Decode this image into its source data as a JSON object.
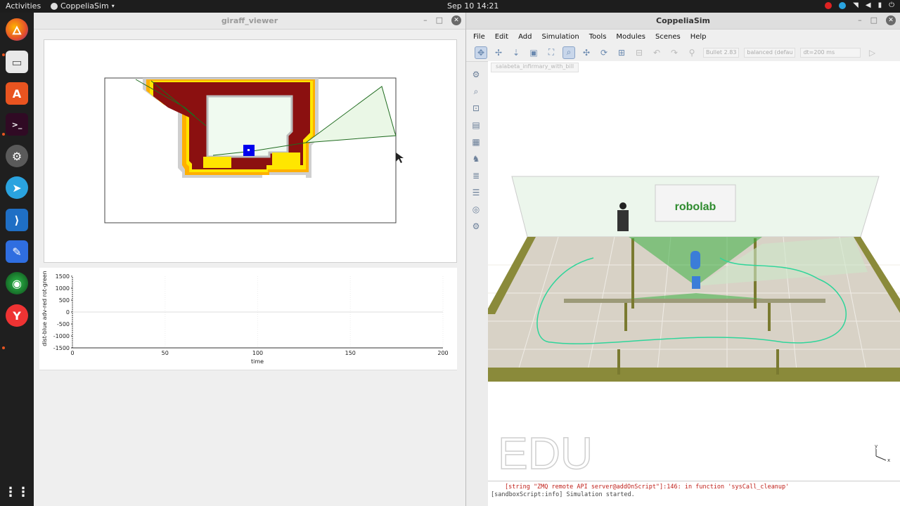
{
  "topbar": {
    "activities": "Activities",
    "app_name": "CoppeliaSim",
    "clock": "Sep 10  14:21"
  },
  "dock": {
    "icons": [
      "firefox-icon",
      "files-icon",
      "app-center-icon",
      "terminal-icon",
      "settings-icon",
      "telegram-icon",
      "vscode-icon",
      "text-editor-icon",
      "robotics-icon",
      "coppelia-icon",
      "show-apps-icon"
    ]
  },
  "giraff": {
    "title": "giraff_viewer",
    "plot": {
      "ylabel": "dist-blue adv-red rot-green",
      "xlabel": "time",
      "yticks": [
        "1500",
        "1000",
        "500",
        "0",
        "-500",
        "-1000",
        "-1500"
      ],
      "xticks": [
        "0",
        "50",
        "100",
        "150",
        "200"
      ]
    }
  },
  "coppelia": {
    "title": "CoppeliaSim",
    "menu": [
      "File",
      "Edit",
      "Add",
      "Simulation",
      "Tools",
      "Modules",
      "Scenes",
      "Help"
    ],
    "toolbar": {
      "engine": "Bullet 2.83",
      "mode": "balanced (defau",
      "dt": "dt=200 ms"
    },
    "scene_tab": "salabeta_infirmary_with_bill",
    "banner": "robolab",
    "watermark": "EDU",
    "console": [
      "[string \"ZMQ remote API server@addOnScript\"]:146: in function 'sysCall_cleanup'",
      "[sandboxScript:info] Simulation started."
    ]
  },
  "colors": {
    "topbar": "#1d1d1d",
    "dock": "#1f1f1f",
    "map_wall": "#8b1010",
    "map_yellow": "#ffe600",
    "map_orange": "#ff9900",
    "robot_blue": "#0000ee",
    "floor": "#d8d2c6",
    "wall": "#8a8a3a",
    "laser": "#3cb043"
  }
}
